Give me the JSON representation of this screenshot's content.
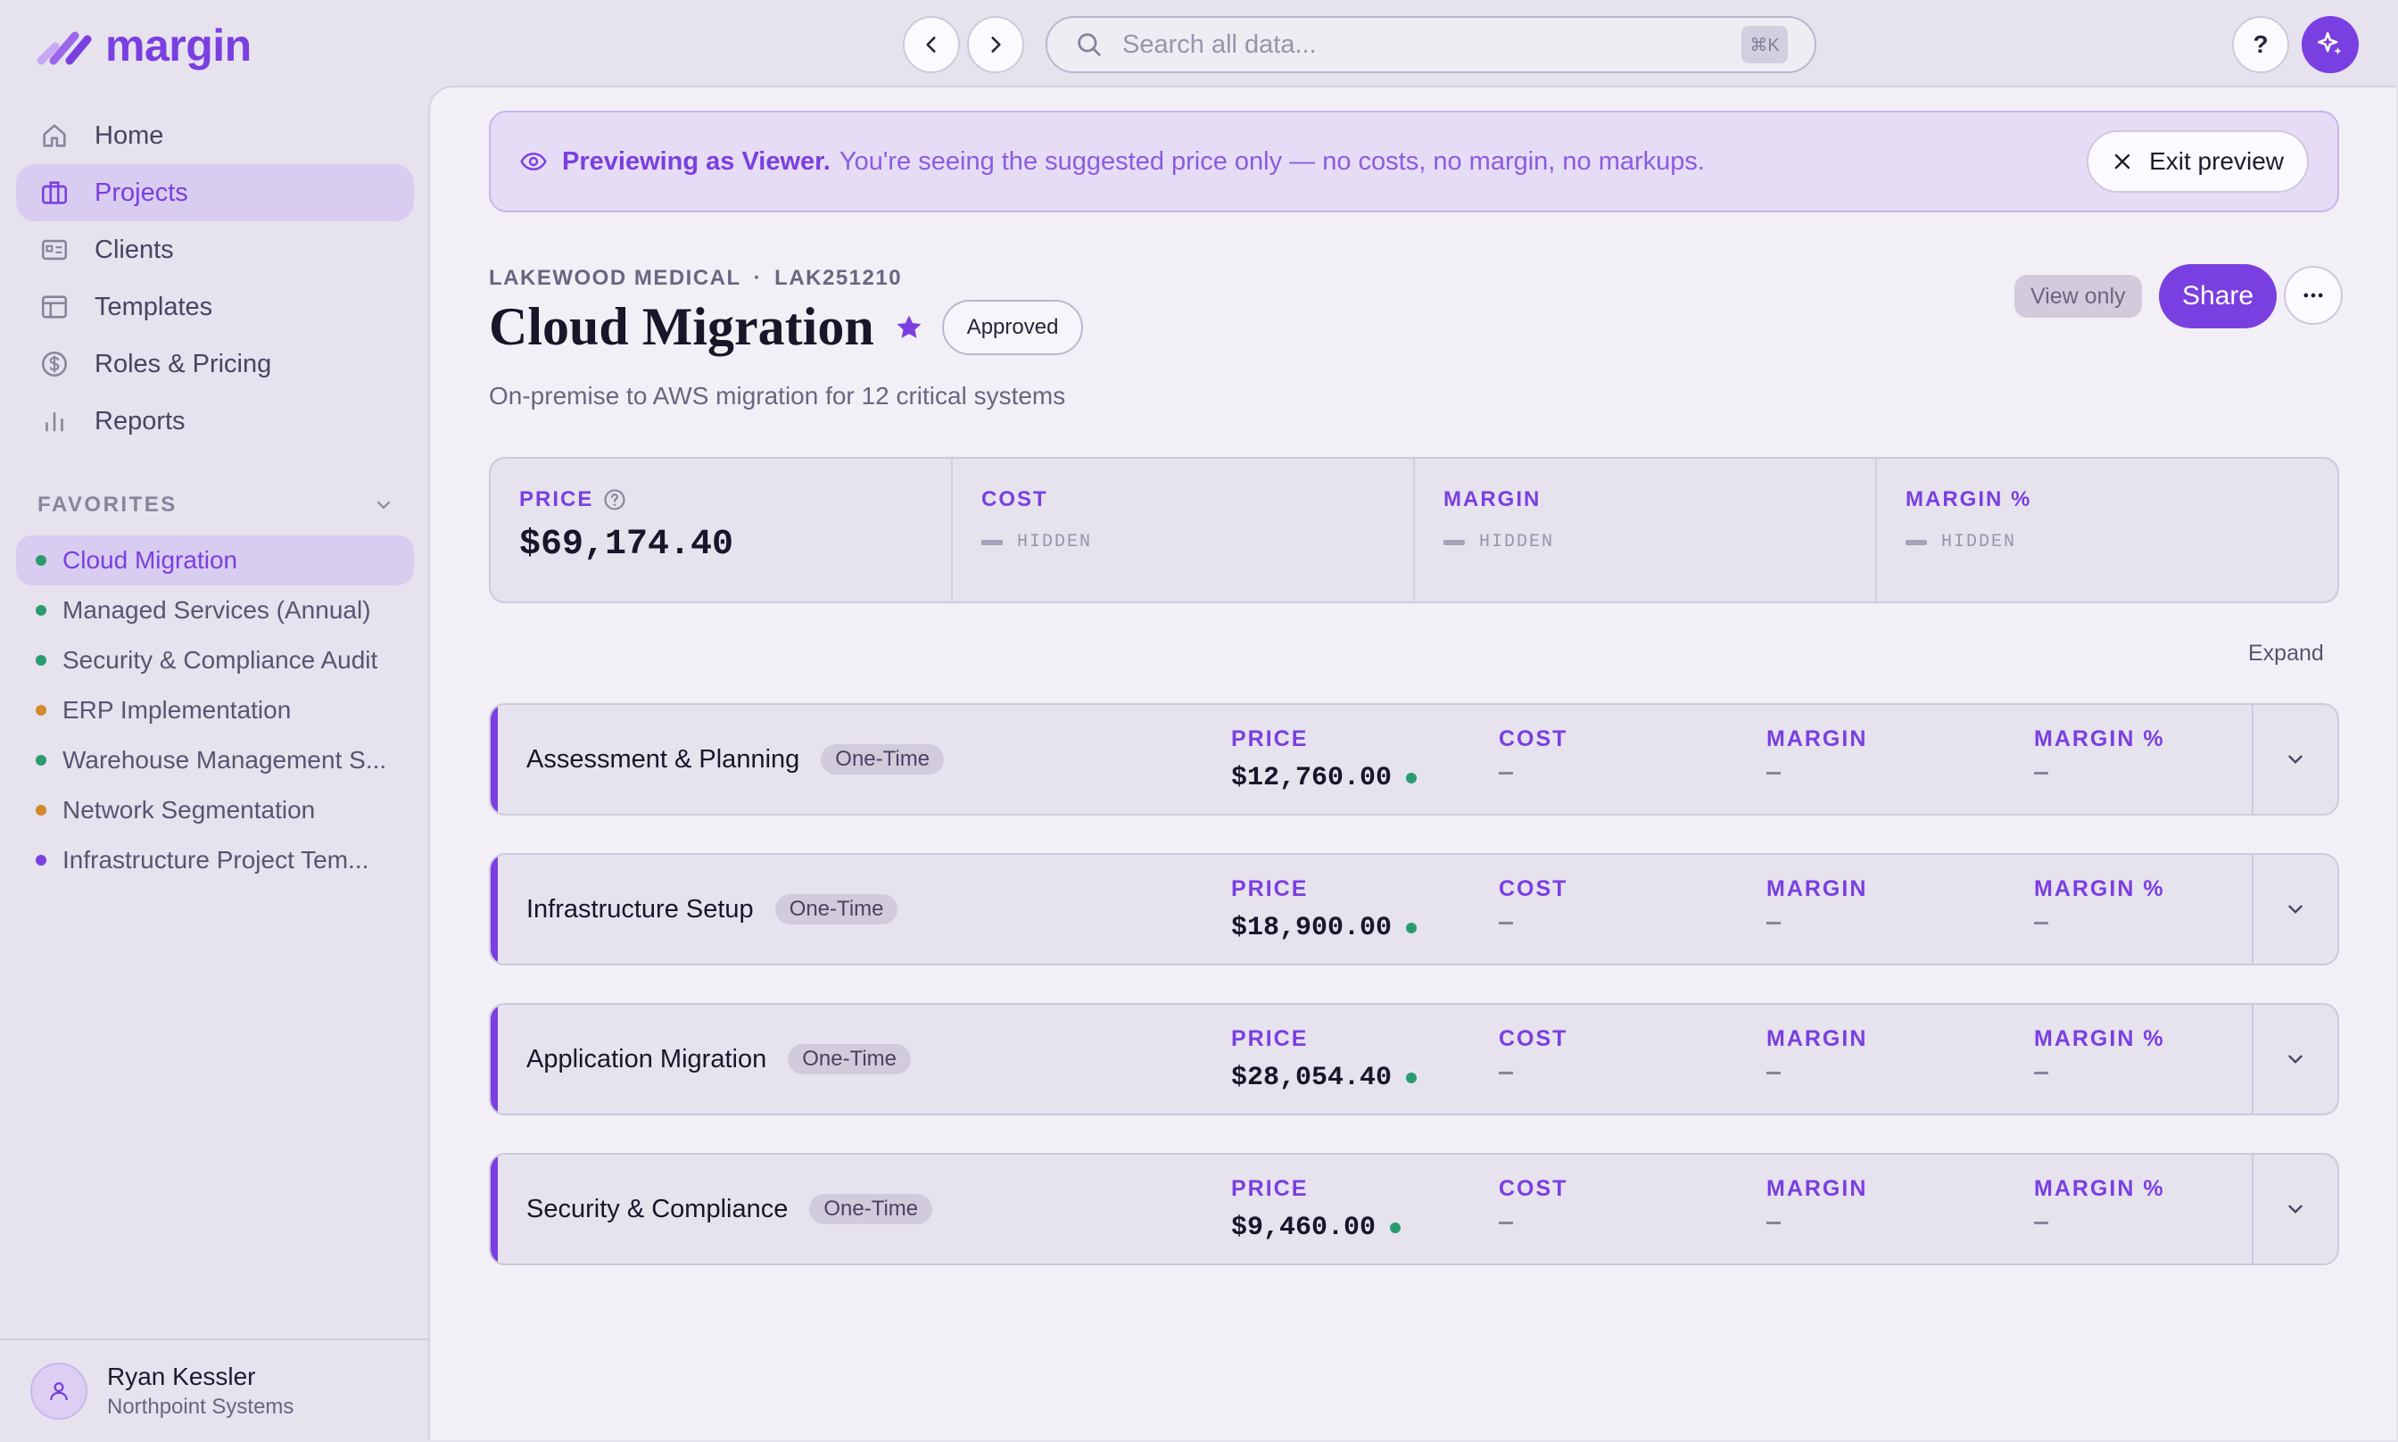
{
  "app": {
    "name": "margin"
  },
  "search": {
    "placeholder": "Search all data...",
    "shortcut": "⌘K"
  },
  "help": {
    "label": "?"
  },
  "sidebar": {
    "items": [
      {
        "label": "Home",
        "icon": "home-icon"
      },
      {
        "label": "Projects",
        "icon": "briefcase-icon",
        "active": true
      },
      {
        "label": "Clients",
        "icon": "id-card-icon"
      },
      {
        "label": "Templates",
        "icon": "layout-icon"
      },
      {
        "label": "Roles & Pricing",
        "icon": "dollar-circle-icon"
      },
      {
        "label": "Reports",
        "icon": "bar-chart-icon"
      }
    ],
    "favorites_label": "FAVORITES",
    "favorites": [
      {
        "label": "Cloud Migration",
        "dot": "#2a9d6e",
        "active": true
      },
      {
        "label": "Managed Services (Annual)",
        "dot": "#2a9d6e"
      },
      {
        "label": "Security & Compliance Audit",
        "dot": "#2a9d6e"
      },
      {
        "label": "ERP Implementation",
        "dot": "#d28a2a"
      },
      {
        "label": "Warehouse Management S...",
        "dot": "#2a9d6e"
      },
      {
        "label": "Network Segmentation",
        "dot": "#d28a2a"
      },
      {
        "label": "Infrastructure Project Tem...",
        "dot": "#7a3fe0"
      }
    ],
    "user": {
      "name": "Ryan Kessler",
      "org": "Northpoint Systems"
    }
  },
  "banner": {
    "strong": "Previewing as Viewer.",
    "text": "You're seeing the suggested price only — no costs, no margin, no markups.",
    "exit_label": "Exit preview"
  },
  "project": {
    "client": "LAKEWOOD MEDICAL",
    "separator": "·",
    "code": "LAK251210",
    "title": "Cloud Migration",
    "status": "Approved",
    "description": "On-premise to AWS migration for 12 critical systems",
    "view_only": "View only",
    "share_label": "Share"
  },
  "summary": {
    "price_label": "PRICE",
    "price_value": "$69,174.40",
    "cost_label": "COST",
    "margin_label": "MARGIN",
    "margin_pct_label": "MARGIN %",
    "hidden_text": "HIDDEN"
  },
  "expand_label": "Expand",
  "phase_labels": {
    "price": "PRICE",
    "cost": "COST",
    "margin": "MARGIN",
    "margin_pct": "MARGIN %"
  },
  "phases": [
    {
      "name": "Assessment & Planning",
      "tag": "One-Time",
      "price": "$12,760.00"
    },
    {
      "name": "Infrastructure Setup",
      "tag": "One-Time",
      "price": "$18,900.00"
    },
    {
      "name": "Application Migration",
      "tag": "One-Time",
      "price": "$28,054.40"
    },
    {
      "name": "Security & Compliance",
      "tag": "One-Time",
      "price": "$9,460.00"
    }
  ],
  "colors": {
    "accent": "#7a3fe0",
    "status_green": "#2a9d6e",
    "status_orange": "#d28a2a"
  }
}
